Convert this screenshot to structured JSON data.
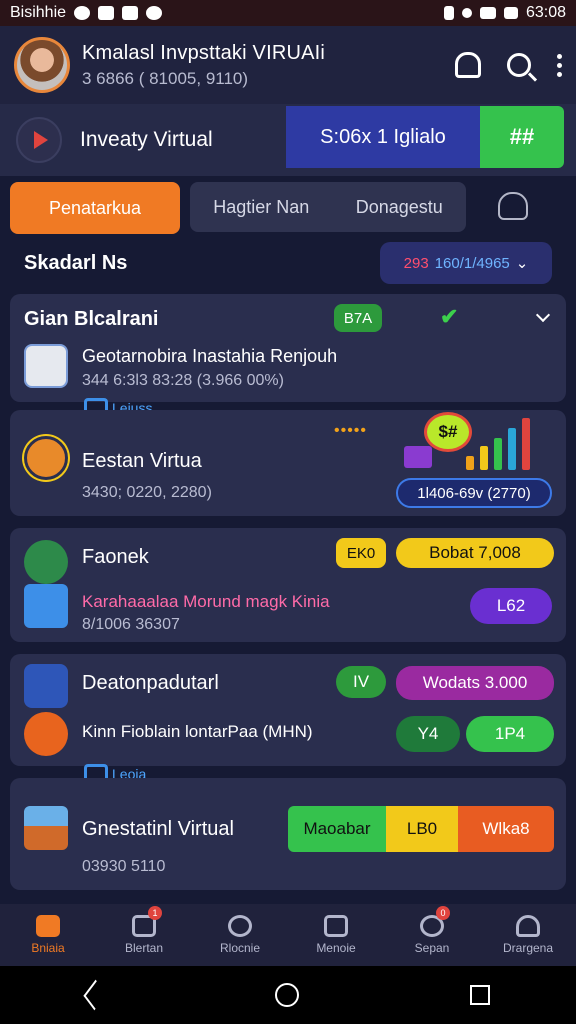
{
  "status_bar": {
    "carrier": "Bisihhie",
    "time": "63:08"
  },
  "app_bar": {
    "title": "Kmalasl Invpsttaki VIRUAIi",
    "subtitle": "3 6866 ( 81005, 9110)"
  },
  "banner": {
    "title": "Inveaty Virtual",
    "stat": "S:06x 1 Iglialo",
    "button": "##"
  },
  "tabs": {
    "active": "Penatarkua",
    "t2": "Hagtier Nan",
    "t3": "Donagestu"
  },
  "section": {
    "title": "Skadarl Ns",
    "select_a": "293",
    "select_b": "160/1/4965"
  },
  "card1": {
    "title": "Gian Blcalrani",
    "pill": "B7A",
    "row_title": "Geotarnobira Inastahia Renjouh",
    "row_sub": "344 6:3l3 83:28 (3.966 00%)"
  },
  "tag1": {
    "label": "Leiuss"
  },
  "card2": {
    "title": "Eestan Virtua",
    "sub": "3430; 0220, 2280)",
    "chip": "$#",
    "stat": "1l406-69v (2770)",
    "dots": "•••••"
  },
  "card3": {
    "title": "Faonek",
    "pill1": "EK0",
    "pill2": "Bobat 7,008",
    "row_title": "Karahaaalaa Morund magk Kinia",
    "row_sub": "8/1006 36307",
    "pill3": "L62"
  },
  "card4": {
    "title": "Deatonpadutarl",
    "pill1": "IV",
    "pill2": "Wodats 3.000",
    "row_title": "Kinn Fioblain lontarPaa (MHN)",
    "pill3": "Y4",
    "pill4": "1P4"
  },
  "tag2": {
    "label": "Leoia"
  },
  "card5": {
    "title": "Gnestatinl Virtual",
    "seg1": "Maoabar",
    "seg2": "LB0",
    "seg3": "Wlka8",
    "sub": "03930 5110"
  },
  "bottom_nav": [
    {
      "label": "Bniaia",
      "active": true
    },
    {
      "label": "Blertan",
      "badge": "1"
    },
    {
      "label": "Rlocnie"
    },
    {
      "label": "Menoie"
    },
    {
      "label": "Sepan",
      "badge": "0"
    },
    {
      "label": "Drargena"
    }
  ],
  "colors": {
    "accent": "#f07a24",
    "green": "#35c24d",
    "blue": "#2e3aa3",
    "purple": "#6a2fd1",
    "magenta": "#9a2aa0",
    "yellow": "#f2c91a"
  }
}
